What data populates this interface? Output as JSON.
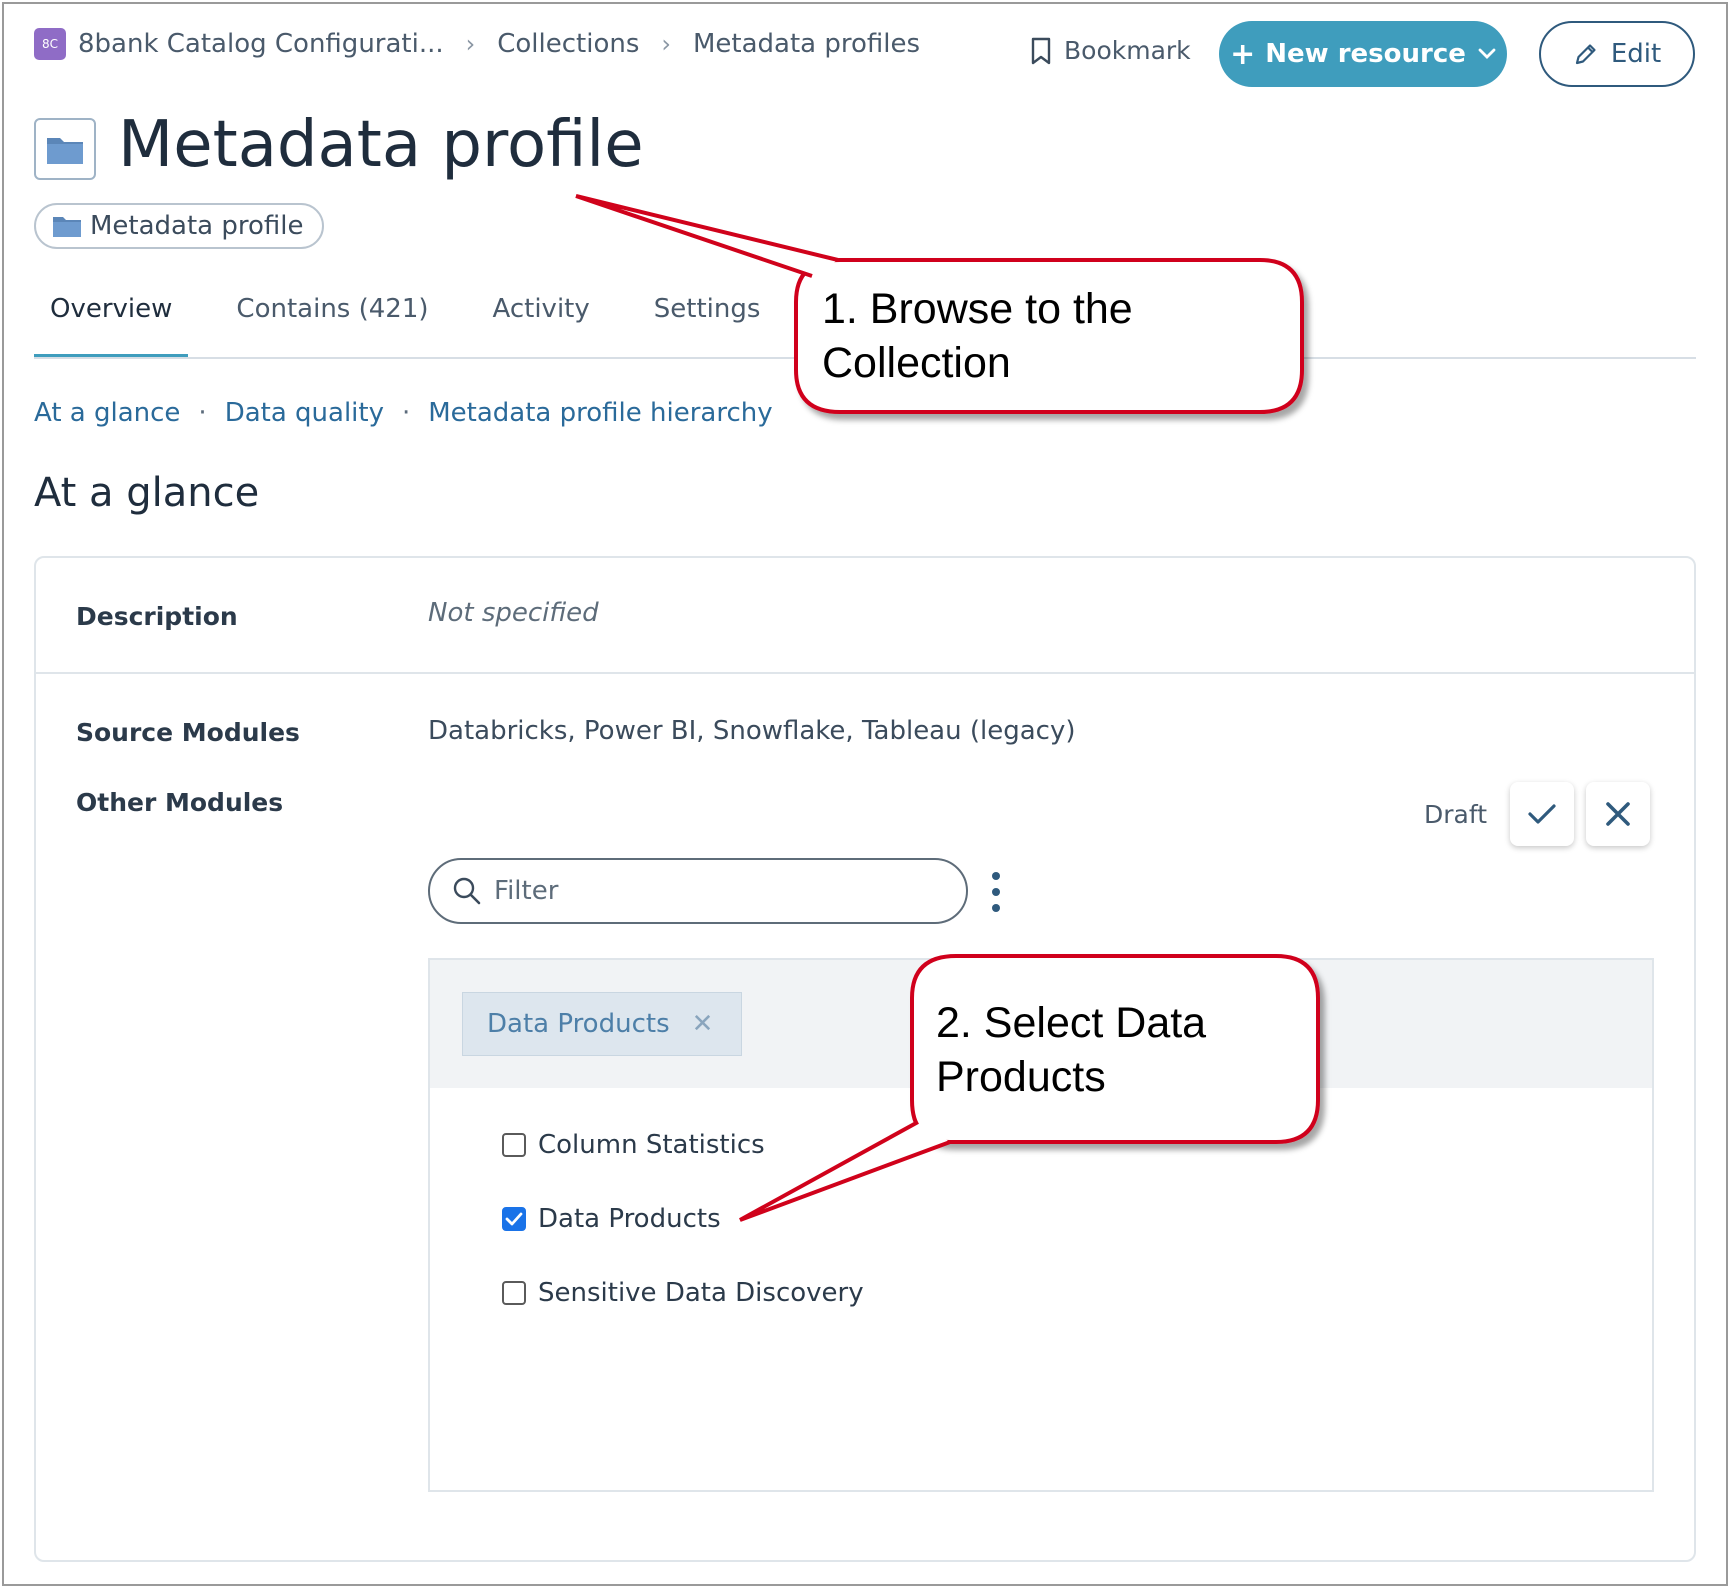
{
  "breadcrumb": {
    "app_badge": "8C",
    "app_name": "8bank Catalog Configurati...",
    "items": [
      "Collections",
      "Metadata profiles"
    ]
  },
  "actions": {
    "bookmark_label": "Bookmark",
    "new_resource_label": "New resource",
    "edit_label": "Edit"
  },
  "page": {
    "title": "Metadata profile",
    "type_chip": "Metadata profile"
  },
  "tabs": [
    "Overview",
    "Contains (421)",
    "Activity",
    "Settings"
  ],
  "active_tab": "Overview",
  "subnav": [
    "At a glance",
    "Data quality",
    "Metadata profile hierarchy"
  ],
  "section_title": "At a glance",
  "card": {
    "description_label": "Description",
    "description_value": "Not specified",
    "source_modules_label": "Source Modules",
    "source_modules_value": "Databricks,  Power BI,  Snowflake,  Tableau (legacy)",
    "other_modules_label": "Other Modules",
    "draft_label": "Draft",
    "filter_placeholder": "Filter",
    "selected_tag": "Data Products",
    "options": [
      {
        "label": "Column Statistics",
        "checked": false
      },
      {
        "label": "Data Products",
        "checked": true
      },
      {
        "label": "Sensitive Data Discovery",
        "checked": false
      }
    ]
  },
  "callouts": {
    "one_line1": "1. Browse to the",
    "one_line2": "Collection",
    "two_line1": "2. Select Data",
    "two_line2": "Products"
  },
  "colors": {
    "accent": "#3f9dbd",
    "link": "#2a6a9a",
    "callout_border": "#d0021b",
    "checkbox": "#1a73e8"
  }
}
